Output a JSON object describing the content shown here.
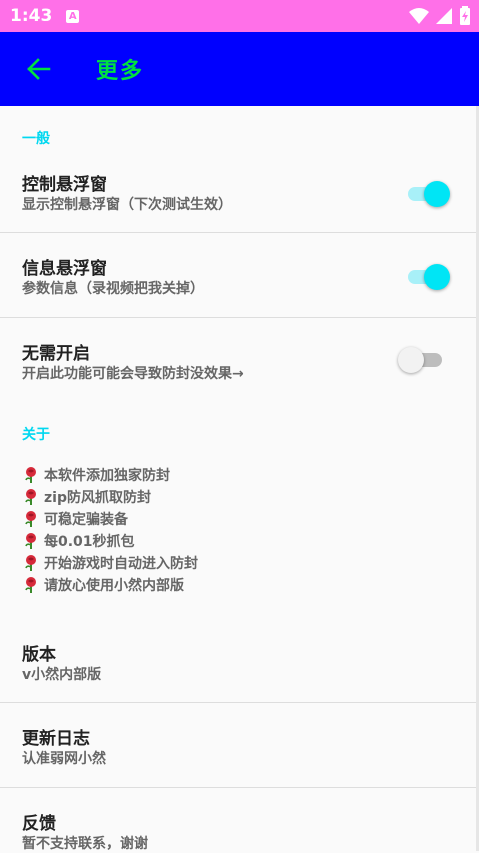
{
  "status_bar": {
    "time": "1:43",
    "notif_letter": "A"
  },
  "app_bar": {
    "title": "更多"
  },
  "sections": {
    "general": "一般",
    "about": "关于"
  },
  "settings": [
    {
      "title": "控制悬浮窗",
      "subtitle": "显示控制悬浮窗（下次测试生效）",
      "enabled": true
    },
    {
      "title": "信息悬浮窗",
      "subtitle": "参数信息（录视频把我关掉）",
      "enabled": true
    },
    {
      "title": "无需开启",
      "subtitle": "开启此功能可能会导致防封没效果→",
      "enabled": false
    }
  ],
  "about_lines": [
    "本软件添加独家防封",
    "zip防风抓取防封",
    "可稳定骗装备",
    "每0.01秒抓包",
    "开始游戏时自动进入防封",
    "请放心使用小然内部版"
  ],
  "info_items": [
    {
      "title": "版本",
      "subtitle": "v小然内部版"
    },
    {
      "title": "更新日志",
      "subtitle": "认准弱网小然"
    },
    {
      "title": "反馈",
      "subtitle": "暂不支持联系，谢谢"
    }
  ],
  "colors": {
    "status_bar": "#ff70e8",
    "app_bar": "#0000ff",
    "title": "#00e040",
    "accent": "#00e5f5"
  }
}
